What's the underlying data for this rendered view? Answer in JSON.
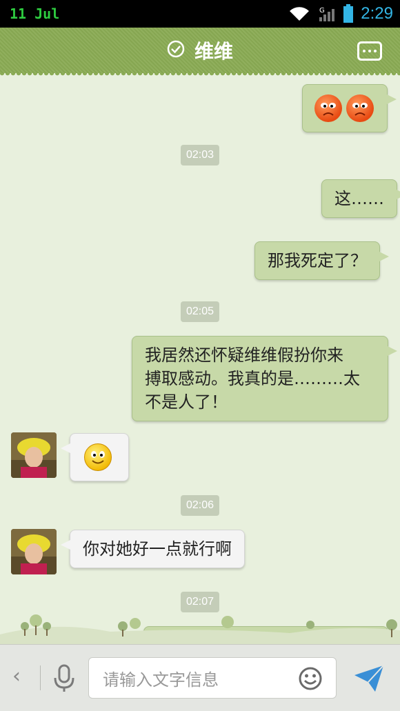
{
  "status": {
    "date": "11  Jul",
    "time": "2:29",
    "network": "G"
  },
  "header": {
    "title": "维维",
    "verified_icon": "check-circle-icon",
    "more_icon": "more-icon"
  },
  "messages": [
    {
      "type": "out-emoji",
      "content": "angry-face ×2"
    },
    {
      "type": "time",
      "text": "02:03"
    },
    {
      "type": "out",
      "text": "这……"
    },
    {
      "type": "out",
      "text": "那我死定了？"
    },
    {
      "type": "time",
      "text": "02:05"
    },
    {
      "type": "out",
      "lines": [
        "我居然还怀疑维维假扮你来",
        "搏取感动。我真的是………太",
        "不是人了！"
      ]
    },
    {
      "type": "in-emoji",
      "content": "smile-face"
    },
    {
      "type": "time",
      "text": "02:06"
    },
    {
      "type": "in",
      "text": "你对她好一点就行啊"
    },
    {
      "type": "time",
      "text": "02:07"
    }
  ],
  "input": {
    "placeholder": "请输入文字信息"
  },
  "colors": {
    "header": "#8aab54",
    "chat_bg": "#e8f0dd",
    "out_bubble": "#c7d9a8",
    "in_bubble": "#f4f4f4",
    "send": "#3a8fd6"
  }
}
